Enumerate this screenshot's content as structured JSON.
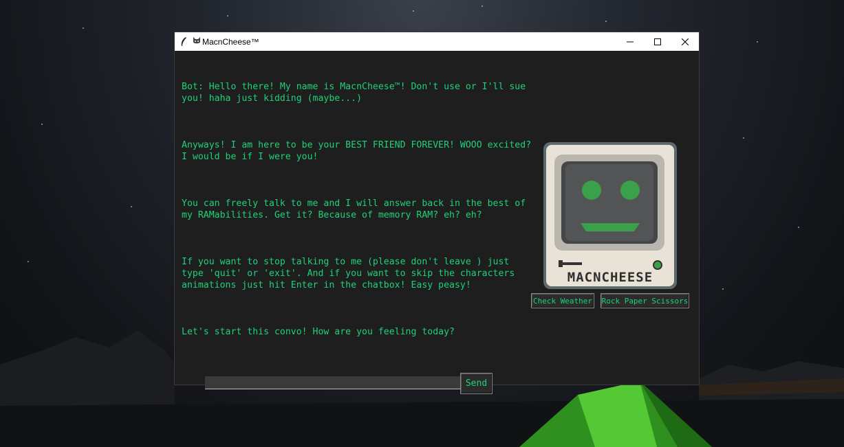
{
  "window": {
    "title": "MacnCheese™",
    "title_icon": "cat-face-icon",
    "app_icon": "feather-icon",
    "controls": [
      "minimize-icon",
      "maximize-icon",
      "close-icon"
    ]
  },
  "chat": {
    "messages": [
      "Bot: Hello there! My name is MacnCheese™! Don't use or I'll sue you! haha just kidding (maybe...)",
      "Anyways! I am here to be your BEST FRIEND FOREVER! WOOO excited? I would be if I were you!",
      "You can freely talk to me and I will answer back in the best of my RAMabilities. Get it? Because of memory RAM? eh? eh?",
      "If you want to stop talking to me (please don't leave ) just type 'quit' or 'exit'. And if you want to skip the characters animations just hit Enter in the chatbox! Easy peasy!",
      "Let's start this convo! How are you feeling today?"
    ]
  },
  "avatar": {
    "label": "MACNCHEESE",
    "face_color": "#3aa04a"
  },
  "actions": {
    "weather_label": "Check Weather",
    "rps_label": "Rock Paper Scissors"
  },
  "input": {
    "value": "",
    "send_label": "Send"
  },
  "colors": {
    "text": "#1fd17a",
    "window_bg": "#1e1e1e"
  }
}
